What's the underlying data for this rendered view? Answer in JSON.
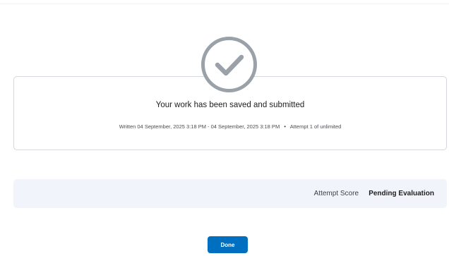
{
  "submission": {
    "icon": "checkmark-circle-icon",
    "message": "Your work has been saved and submitted",
    "written_range": "Written 04 September, 2025 3:18 PM - 04 September, 2025 3:18 PM",
    "separator": "•",
    "attempt": "Attempt 1 of unlimited"
  },
  "score": {
    "label": "Attempt Score",
    "value": "Pending Evaluation"
  },
  "actions": {
    "done_label": "Done"
  },
  "colors": {
    "primary_button": "#006fbf",
    "check_icon": "#9aa1a8",
    "score_bar_bg": "#f1f4fa",
    "card_border": "#d4d7db"
  }
}
